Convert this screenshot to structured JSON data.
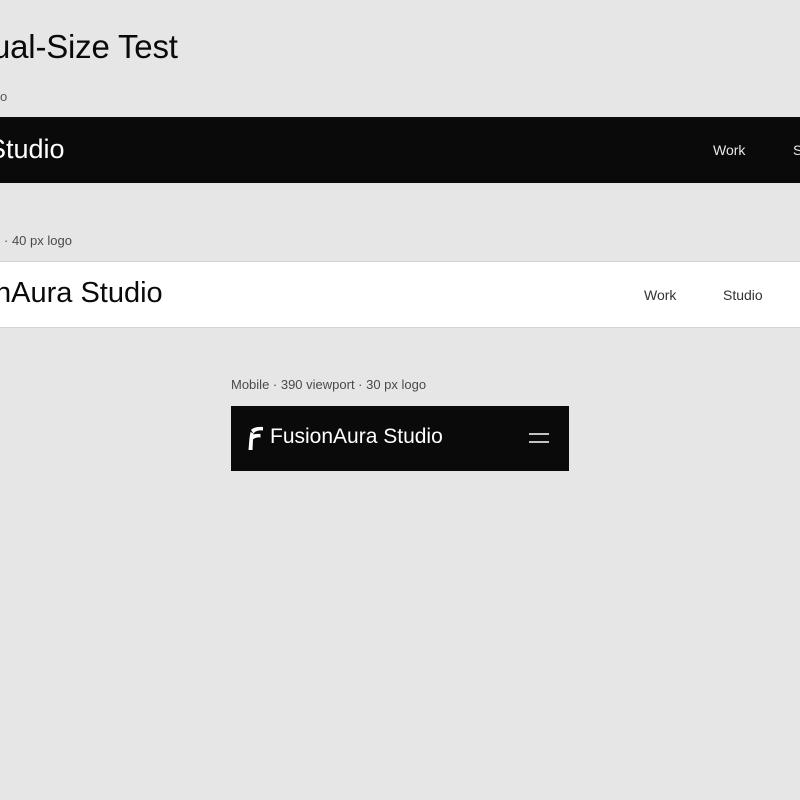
{
  "page": {
    "title": "ual-Size Test",
    "intro_caption": "o"
  },
  "sections": [
    {
      "caption": "",
      "navbar": {
        "theme": "dark",
        "brand": "Studio",
        "links": [
          "Work",
          "S"
        ]
      }
    },
    {
      "caption": "· 40 px logo",
      "navbar": {
        "theme": "light",
        "brand": "nAura Studio",
        "links": [
          "Work",
          "Studio"
        ]
      }
    },
    {
      "caption": "Mobile · 390 viewport · 30 px logo",
      "navbar": {
        "theme": "dark",
        "brand": "FusionAura Studio",
        "logo_icon": "fusionaura-f-logo-icon",
        "menu_icon": "hamburger-menu-icon"
      }
    }
  ],
  "colors": {
    "page_background": "#e6e6e6",
    "dark_navbar": "#0a0a0a",
    "light_navbar": "#ffffff",
    "text_dark": "#0a0a0a",
    "text_light": "#ffffff"
  }
}
